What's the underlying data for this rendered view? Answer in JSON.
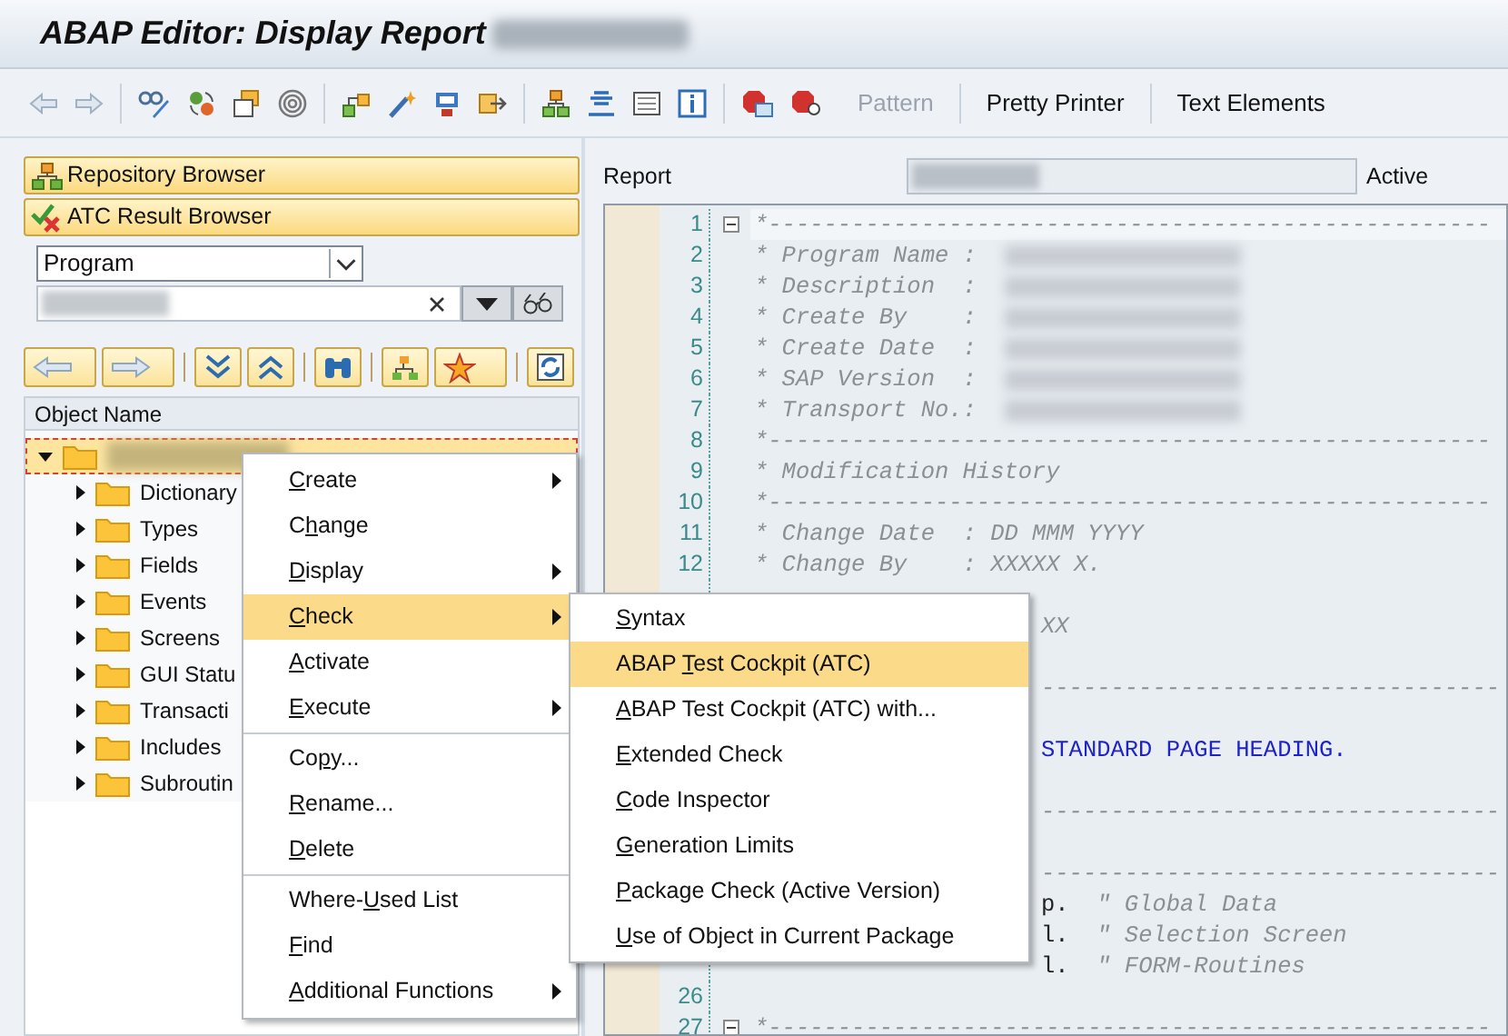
{
  "window": {
    "title": "ABAP Editor: Display Report"
  },
  "toolbar": {
    "buttons": [
      {
        "label": "Pattern",
        "disabled": true
      },
      {
        "label": "Pretty Printer",
        "disabled": false
      },
      {
        "label": "Text Elements",
        "disabled": false
      }
    ]
  },
  "navigator": {
    "buttons": [
      {
        "label": "Repository Browser",
        "kind": "repository"
      },
      {
        "label": "ATC Result Browser",
        "kind": "atc"
      }
    ],
    "object_type": {
      "value": "Program"
    },
    "tree": {
      "header": "Object Name",
      "nodes": [
        {
          "selected": true,
          "expanded": true,
          "children": [
            {
              "label": "Dictionary",
              "expanded": false
            },
            {
              "label": "Types",
              "expanded": false
            },
            {
              "label": "Fields",
              "expanded": false
            },
            {
              "label": "Events",
              "expanded": false
            },
            {
              "label": "Screens",
              "expanded": false
            },
            {
              "label": "GUI Statu",
              "expanded": false
            },
            {
              "label": "Transacti",
              "expanded": false
            },
            {
              "label": "Includes",
              "expanded": false
            },
            {
              "label": "Subroutin",
              "expanded": false
            }
          ]
        }
      ]
    }
  },
  "editor": {
    "report_label": "Report",
    "status": "Active",
    "lines": [
      {
        "number": "1",
        "collapsible": true,
        "parts": [
          {
            "kind": "comment",
            "text": "*----------------------------------------------------"
          }
        ]
      },
      {
        "number": "2",
        "collapsible": false,
        "parts": [
          {
            "kind": "comment",
            "text": "* Program Name : "
          },
          {
            "kind": "redacted"
          }
        ]
      },
      {
        "number": "3",
        "collapsible": false,
        "parts": [
          {
            "kind": "comment",
            "text": "* Description  : "
          },
          {
            "kind": "redacted"
          }
        ]
      },
      {
        "number": "4",
        "collapsible": false,
        "parts": [
          {
            "kind": "comment",
            "text": "* Create By    : "
          },
          {
            "kind": "redacted"
          }
        ]
      },
      {
        "number": "5",
        "collapsible": false,
        "parts": [
          {
            "kind": "comment",
            "text": "* Create Date  : "
          },
          {
            "kind": "redacted"
          }
        ]
      },
      {
        "number": "6",
        "collapsible": false,
        "parts": [
          {
            "kind": "comment",
            "text": "* SAP Version  : "
          },
          {
            "kind": "redacted"
          }
        ]
      },
      {
        "number": "7",
        "collapsible": false,
        "parts": [
          {
            "kind": "comment",
            "text": "* Transport No.: "
          },
          {
            "kind": "redacted"
          }
        ]
      },
      {
        "number": "8",
        "collapsible": false,
        "parts": [
          {
            "kind": "comment",
            "text": "*----------------------------------------------------"
          }
        ]
      },
      {
        "number": "9",
        "collapsible": false,
        "parts": [
          {
            "kind": "comment",
            "text": "* Modification History"
          }
        ]
      },
      {
        "number": "10",
        "collapsible": false,
        "parts": [
          {
            "kind": "comment",
            "text": "*----------------------------------------------------"
          }
        ]
      },
      {
        "number": "11",
        "collapsible": false,
        "parts": [
          {
            "kind": "comment",
            "text": "* Change Date  : DD MMM YYYY"
          }
        ]
      },
      {
        "number": "12",
        "collapsible": false,
        "parts": [
          {
            "kind": "comment",
            "text": "* Change By    : XXXXX X."
          }
        ]
      },
      {
        "kind": "hidden"
      },
      {
        "kind": "tail",
        "parts": [
          {
            "kind": "comment",
            "text": "XX"
          }
        ]
      },
      {
        "kind": "hidden"
      },
      {
        "kind": "tail",
        "parts": [
          {
            "kind": "comment",
            "text": "---------------------------------"
          }
        ]
      },
      {
        "kind": "hidden"
      },
      {
        "kind": "tail",
        "parts": [
          {
            "kind": "keyword",
            "text": "STANDARD PAGE HEADING."
          }
        ]
      },
      {
        "kind": "hidden"
      },
      {
        "kind": "tail",
        "parts": [
          {
            "kind": "comment",
            "text": "---------------------------------"
          }
        ]
      },
      {
        "kind": "hidden"
      },
      {
        "kind": "tail",
        "parts": [
          {
            "kind": "comment",
            "text": "---------------------------------"
          }
        ]
      },
      {
        "kind": "tail",
        "parts": [
          {
            "kind": "code",
            "text": "p."
          },
          {
            "kind": "comment",
            "text": "  \" Global Data"
          }
        ]
      },
      {
        "kind": "tail",
        "parts": [
          {
            "kind": "code",
            "text": "l."
          },
          {
            "kind": "comment",
            "text": "  \" Selection Screen"
          }
        ]
      },
      {
        "kind": "tail",
        "parts": [
          {
            "kind": "code",
            "text": "l."
          },
          {
            "kind": "comment",
            "text": "  \" FORM-Routines"
          }
        ]
      },
      {
        "number": "26",
        "collapsible": false
      },
      {
        "number": "27",
        "collapsible": true,
        "parts": [
          {
            "kind": "comment",
            "text": "*----------------------------------------------------"
          }
        ]
      }
    ]
  },
  "context_menu": {
    "items": [
      {
        "kind": "item",
        "label": {
          "key": "C",
          "post": "reate"
        },
        "submenu": true,
        "selected": false
      },
      {
        "kind": "item",
        "label": {
          "pre": "C",
          "key": "h",
          "post": "ange"
        },
        "submenu": false,
        "selected": false
      },
      {
        "kind": "item",
        "label": {
          "key": "D",
          "post": "isplay"
        },
        "submenu": true,
        "selected": false
      },
      {
        "kind": "item",
        "label": {
          "key": "C",
          "post": "heck"
        },
        "submenu": true,
        "selected": true
      },
      {
        "kind": "item",
        "label": {
          "key": "A",
          "post": "ctivate"
        },
        "submenu": false,
        "selected": false
      },
      {
        "kind": "item",
        "label": {
          "key": "E",
          "post": "xecute"
        },
        "submenu": true,
        "selected": false
      },
      {
        "kind": "separator"
      },
      {
        "kind": "item",
        "label": {
          "pre": "Co",
          "key": "p",
          "post": "y..."
        },
        "submenu": false,
        "selected": false
      },
      {
        "kind": "item",
        "label": {
          "key": "R",
          "post": "ename..."
        },
        "submenu": false,
        "selected": false
      },
      {
        "kind": "item",
        "label": {
          "key": "D",
          "post": "elete"
        },
        "submenu": false,
        "selected": false
      },
      {
        "kind": "separator"
      },
      {
        "kind": "item",
        "label": {
          "pre": "Where-",
          "key": "U",
          "post": "sed List"
        },
        "submenu": false,
        "selected": false
      },
      {
        "kind": "item",
        "label": {
          "key": "F",
          "post": "ind"
        },
        "submenu": false,
        "selected": false
      },
      {
        "kind": "item",
        "label": {
          "key": "A",
          "post": "dditional Functions"
        },
        "submenu": true,
        "selected": false
      }
    ]
  },
  "check_submenu": {
    "items": [
      {
        "kind": "item",
        "label": {
          "key": "S",
          "post": "yntax"
        },
        "submenu": false,
        "selected": false
      },
      {
        "kind": "item",
        "label": {
          "pre": "ABAP ",
          "key": "T",
          "post": "est Cockpit (ATC)"
        },
        "submenu": false,
        "selected": true
      },
      {
        "kind": "item",
        "label": {
          "key": "A",
          "post": "BAP Test Cockpit (ATC) with..."
        },
        "submenu": false,
        "selected": false
      },
      {
        "kind": "item",
        "label": {
          "key": "E",
          "post": "xtended Check"
        },
        "submenu": false,
        "selected": false
      },
      {
        "kind": "item",
        "label": {
          "key": "C",
          "post": "ode Inspector"
        },
        "submenu": false,
        "selected": false
      },
      {
        "kind": "item",
        "label": {
          "key": "G",
          "post": "eneration Limits"
        },
        "submenu": false,
        "selected": false
      },
      {
        "kind": "item",
        "label": {
          "key": "P",
          "post": "ackage Check (Active Version)"
        },
        "submenu": false,
        "selected": false
      },
      {
        "kind": "item",
        "label": {
          "key": "U",
          "post": "se of Object in Current Package"
        },
        "submenu": false,
        "selected": false
      }
    ]
  }
}
